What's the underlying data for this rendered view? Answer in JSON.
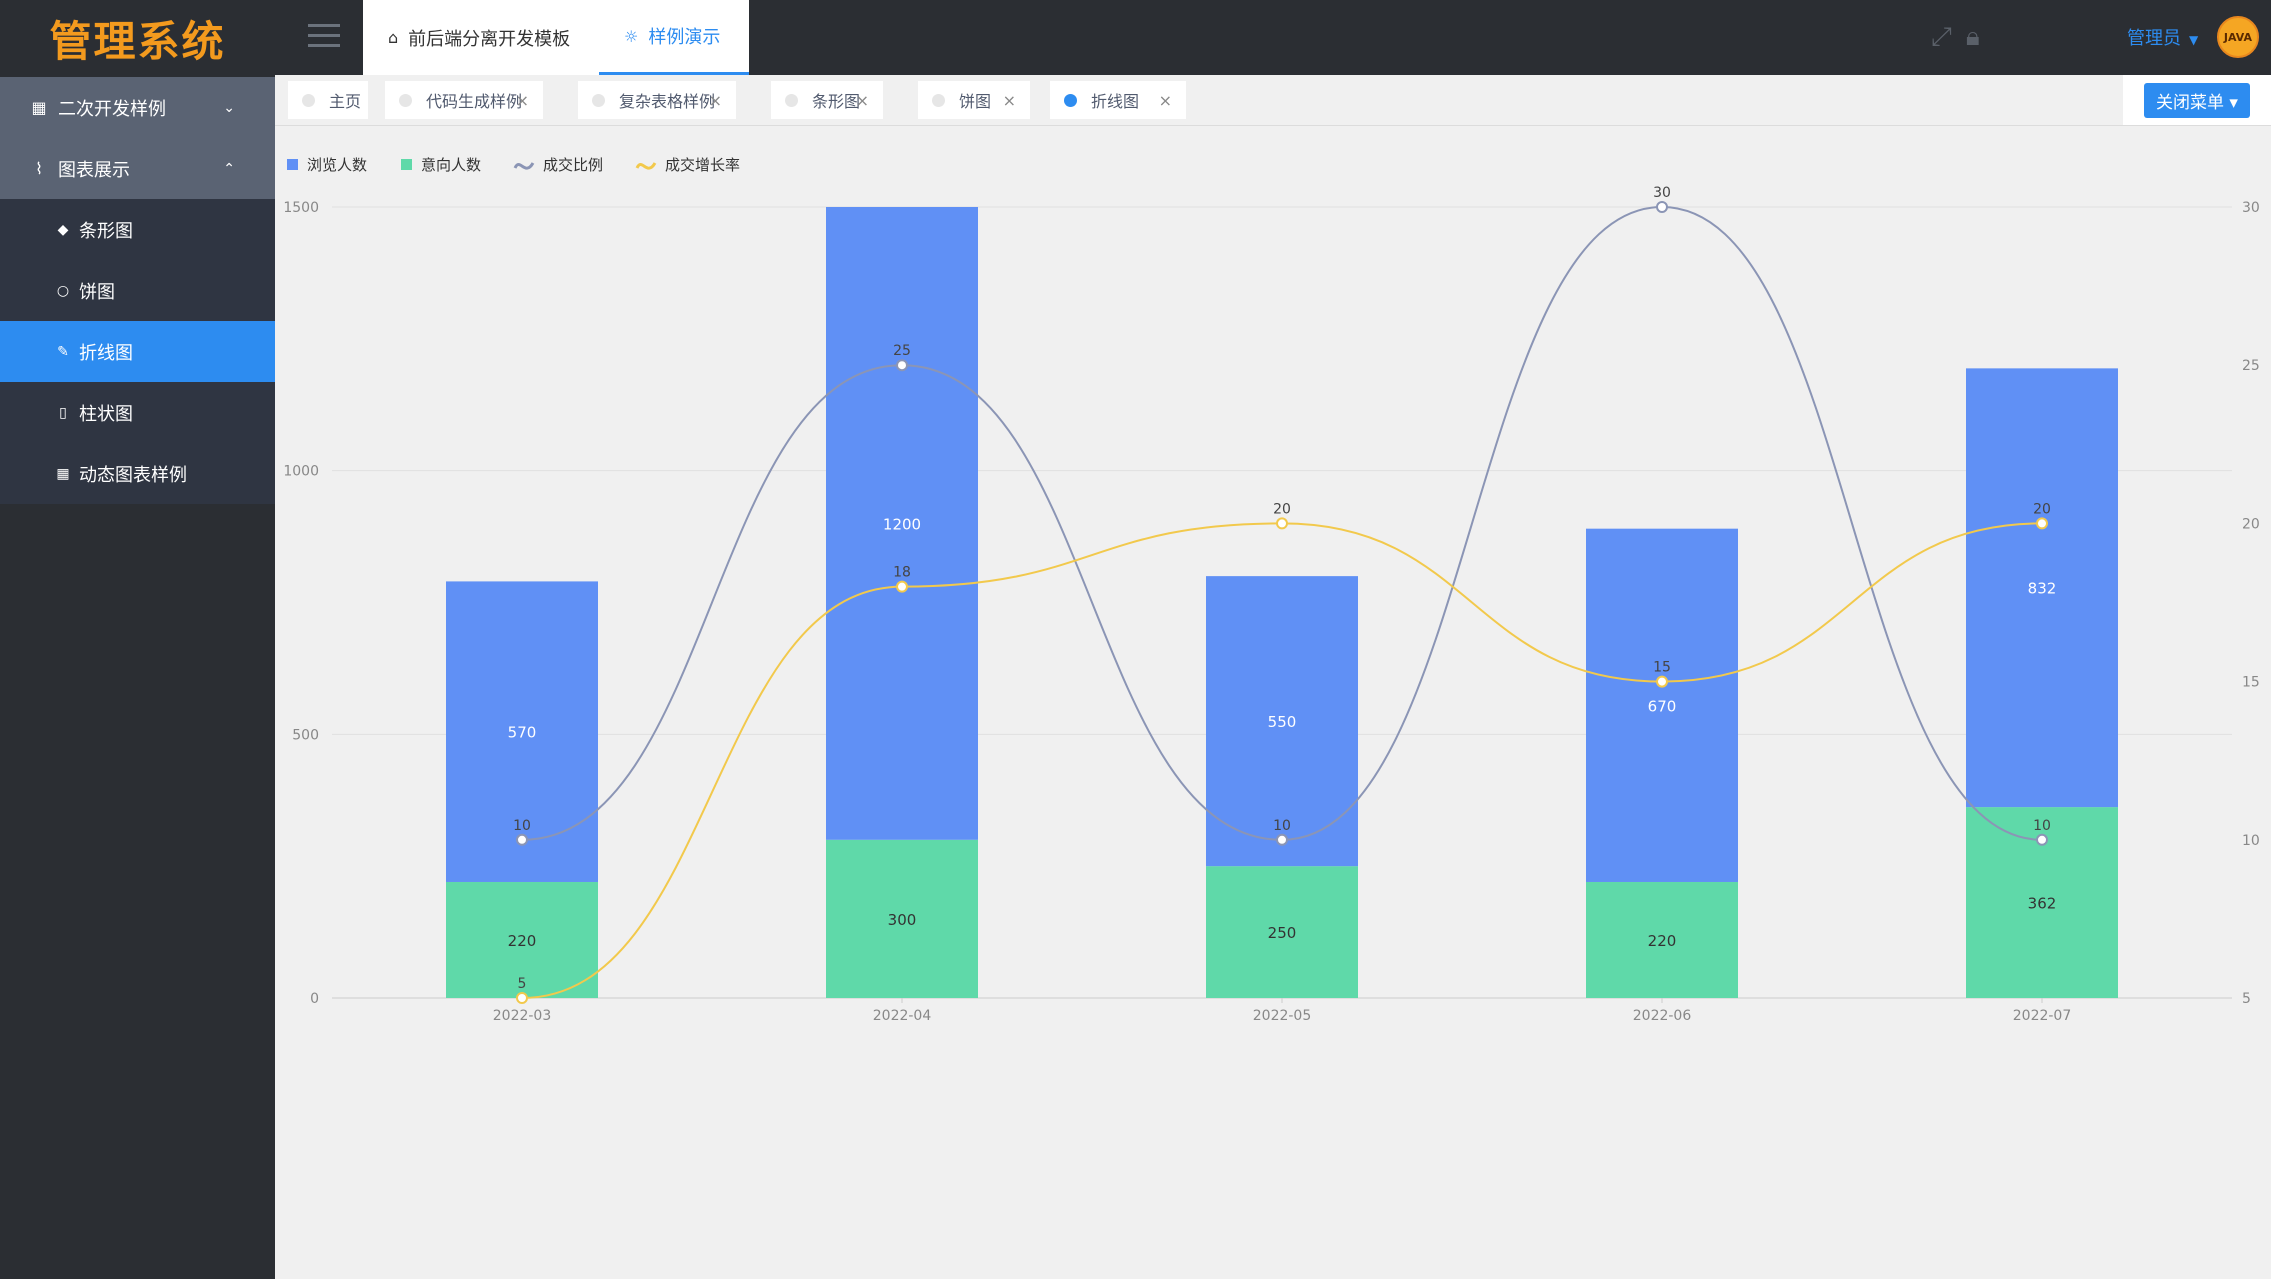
{
  "app": {
    "logo": "管理系统"
  },
  "sidebar": {
    "groups": [
      {
        "label": "二次开发样例",
        "icon": "grid-icon",
        "expanded": false
      },
      {
        "label": "图表展示",
        "icon": "pulse-icon",
        "expanded": true
      }
    ],
    "items": [
      {
        "label": "条形图",
        "icon": "tag-icon",
        "active": false
      },
      {
        "label": "饼图",
        "icon": "circle-icon",
        "active": false
      },
      {
        "label": "折线图",
        "icon": "pencil-icon",
        "active": true
      },
      {
        "label": "柱状图",
        "icon": "phone-icon",
        "active": false
      },
      {
        "label": "动态图表样例",
        "icon": "grid-icon",
        "active": false
      }
    ]
  },
  "header": {
    "tabs": [
      {
        "label": "前后端分离开发模板",
        "icon": "home-icon"
      },
      {
        "label": "样例演示",
        "icon": "bulb-icon"
      }
    ],
    "user": "管理员",
    "avatar_text": "JAVA"
  },
  "tabbar": {
    "tabs": [
      {
        "label": "主页",
        "closable": false,
        "active": false
      },
      {
        "label": "代码生成样例",
        "closable": true,
        "active": false
      },
      {
        "label": "复杂表格样例",
        "closable": true,
        "active": false
      },
      {
        "label": "条形图",
        "closable": true,
        "active": false
      },
      {
        "label": "饼图",
        "closable": true,
        "active": false
      },
      {
        "label": "折线图",
        "closable": true,
        "active": true
      }
    ],
    "close_menu": "关闭菜单"
  },
  "chart_data": {
    "type": "bar",
    "categories": [
      "2022-03",
      "2022-04",
      "2022-05",
      "2022-06",
      "2022-07"
    ],
    "series": [
      {
        "name": "浏览人数",
        "type": "bar",
        "stack": true,
        "axis": "left",
        "color": "#6090f5",
        "values": [
          570,
          1200,
          550,
          670,
          832
        ]
      },
      {
        "name": "意向人数",
        "type": "bar",
        "stack": true,
        "axis": "left",
        "color": "#5fd9a9",
        "values": [
          220,
          300,
          250,
          220,
          362
        ]
      },
      {
        "name": "成交比例",
        "type": "line",
        "smooth": true,
        "axis": "right",
        "color": "#8b95b5",
        "values": [
          10,
          25,
          10,
          30,
          10
        ]
      },
      {
        "name": "成交增长率",
        "type": "line",
        "smooth": true,
        "axis": "right",
        "color": "#f2c94c",
        "values": [
          5,
          18,
          20,
          15,
          20
        ]
      }
    ],
    "y_left": {
      "min": 0,
      "max": 1500,
      "ticks": [
        0,
        500,
        1000,
        1500
      ]
    },
    "y_right": {
      "min": 5,
      "max": 30,
      "ticks": [
        5,
        10,
        15,
        20,
        25,
        30
      ]
    },
    "legend_position": "top-left",
    "grid": true
  }
}
